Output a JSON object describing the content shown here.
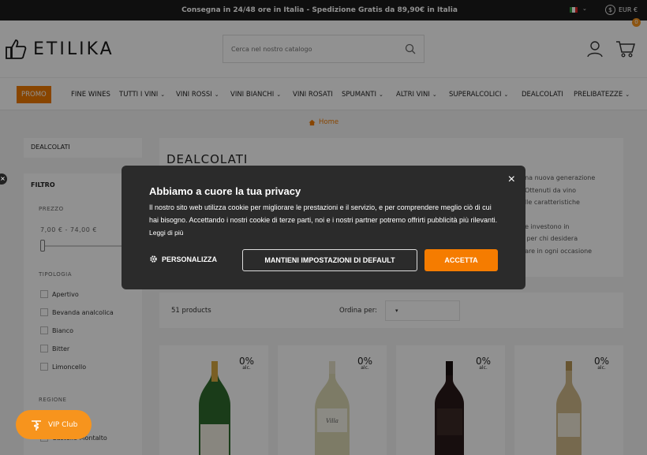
{
  "topbar": {
    "message": "Consegna in 24/48 ore in Italia - Spedizione Gratis da 89,90€ in Italia",
    "currency": "EUR €",
    "currency_caret": "⌄",
    "language_caret": "⌄"
  },
  "header": {
    "logo_text": "ETILIKA",
    "search_placeholder": "Cerca nel nostro catalogo",
    "cart_count": "0"
  },
  "nav": {
    "items": [
      {
        "label": "PROMO"
      },
      {
        "label": "FINE WINES"
      },
      {
        "label": "TUTTI I VINI"
      },
      {
        "label": "VINI ROSSI"
      },
      {
        "label": "VINI BIANCHI"
      },
      {
        "label": "VINI ROSATI"
      },
      {
        "label": "SPUMANTI"
      },
      {
        "label": "ALTRI VINI"
      },
      {
        "label": "SUPERALCOLICI"
      },
      {
        "label": "DEALCOLATI"
      },
      {
        "label": "PRELIBATEZZE"
      }
    ],
    "caret": "⌄"
  },
  "breadcrumb": {
    "home": "Home"
  },
  "sidebar": {
    "category": "DEALCOLATI",
    "filter_title": "FILTRO",
    "price_label": "PREZZO",
    "price_range": "7,00 € - 74,00 €",
    "price_handle_fraction": 0,
    "typology_label": "TIPOLOGIA",
    "typology_items": [
      "Apertivo",
      "Bevanda analcolica",
      "Bianco",
      "Bitter",
      "Limoncello"
    ],
    "region_label": "REGIONE",
    "region_items": [
      "Castello Montalto"
    ]
  },
  "category": {
    "title": "DEALCOLATI",
    "desc_lines": [
      "una nuova generazione",
      ". Ottenuti da vino",
      "elle caratteristiche",
      "",
      "he investono in",
      "e per chi desidera",
      "dare in ogni occasione"
    ]
  },
  "toolbar": {
    "count": "51 products",
    "sort_label": "Ordina per:",
    "sort_value": "▾"
  },
  "products": [
    {
      "pct": "0%",
      "alc": "alc."
    },
    {
      "pct": "0%",
      "alc": "alc."
    },
    {
      "pct": "0%",
      "alc": "alc."
    },
    {
      "pct": "0%",
      "alc": "alc."
    }
  ],
  "vip": {
    "label": "VIP Club"
  },
  "left_close": "×",
  "cookie": {
    "title": "Abbiamo a cuore la tua privacy",
    "text": "Il nostro sito web utilizza cookie per migliorare le prestazioni e il servizio, e per comprendere meglio ciò di cui hai bisogno. Accettando i nostri cookie di terze parti, noi e i nostri partner potremo offrirti pubblicità più rilevanti.",
    "link": "Leggi di più",
    "personalize": "PERSONALIZZA",
    "default_button": "MANTIENI IMPOSTAZIONI DI DEFAULT",
    "accept_button": "ACCETTA",
    "close": "×"
  },
  "colors": {
    "accent": "#f07a00",
    "accept": "#f57c00",
    "dark": "#1c1c1c",
    "modal": "#2b2b2b"
  }
}
